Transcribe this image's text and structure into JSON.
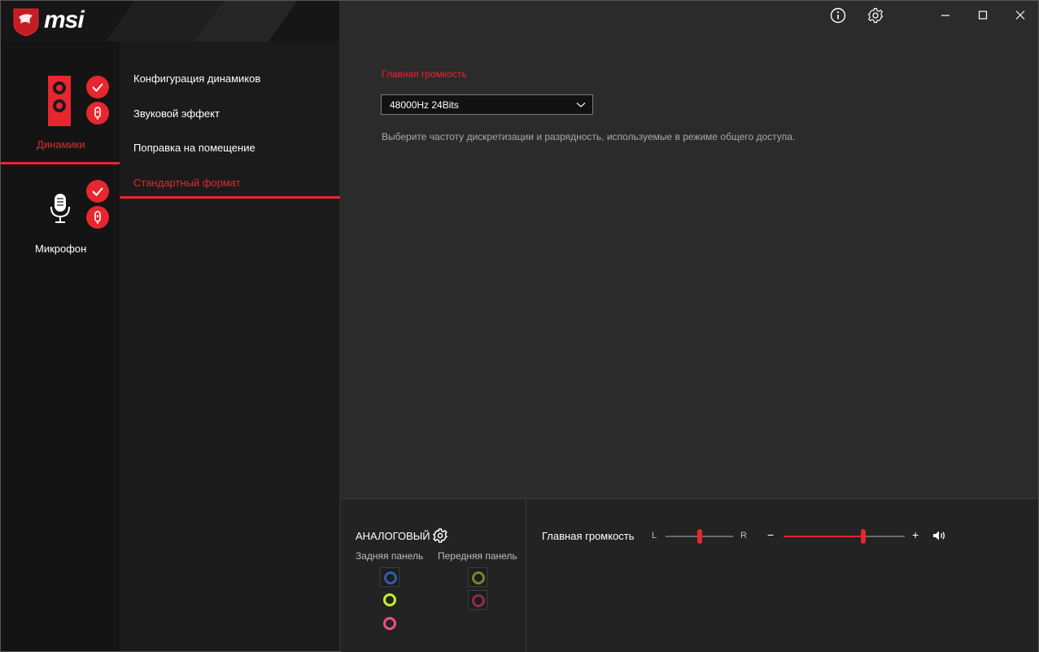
{
  "app": {
    "brand": "msi"
  },
  "devices": [
    {
      "label": "Динамики",
      "active": true
    },
    {
      "label": "Микрофон",
      "active": false
    }
  ],
  "menu": {
    "items": [
      {
        "label": "Конфигурация динамиков"
      },
      {
        "label": "Звуковой эффект"
      },
      {
        "label": "Поправка на помещение"
      },
      {
        "label": "Стандартный формат",
        "active": true
      }
    ]
  },
  "content": {
    "section_title": "Главная громкость",
    "format_value": "48000Hz 24Bits",
    "description": "Выберите частоту дискретизации и разрядность, используемые в режиме общего доступа."
  },
  "bottom": {
    "analog_label": "АНАЛОГОВЫЙ",
    "rear_panel_label": "Задняя панель",
    "front_panel_label": "Передняя панель",
    "rear_jacks": [
      {
        "color": "#2f5fa8"
      },
      {
        "color": "#c6ee29"
      },
      {
        "color": "#f0517e"
      }
    ],
    "front_jacks": [
      {
        "color": "#6d8a2a"
      },
      {
        "color": "#8b2e47"
      }
    ],
    "volume_label": "Главная громкость",
    "balance_left": "L",
    "balance_right": "R",
    "balance_value": 0.5,
    "minus": "−",
    "plus": "+",
    "volume_value": 0.66
  },
  "colors": {
    "accent": "#e8262f"
  },
  "icons": {
    "info": "info-icon",
    "settings": "gear-icon",
    "minimize": "minimize-icon",
    "maximize": "maximize-icon",
    "close": "close-icon"
  }
}
